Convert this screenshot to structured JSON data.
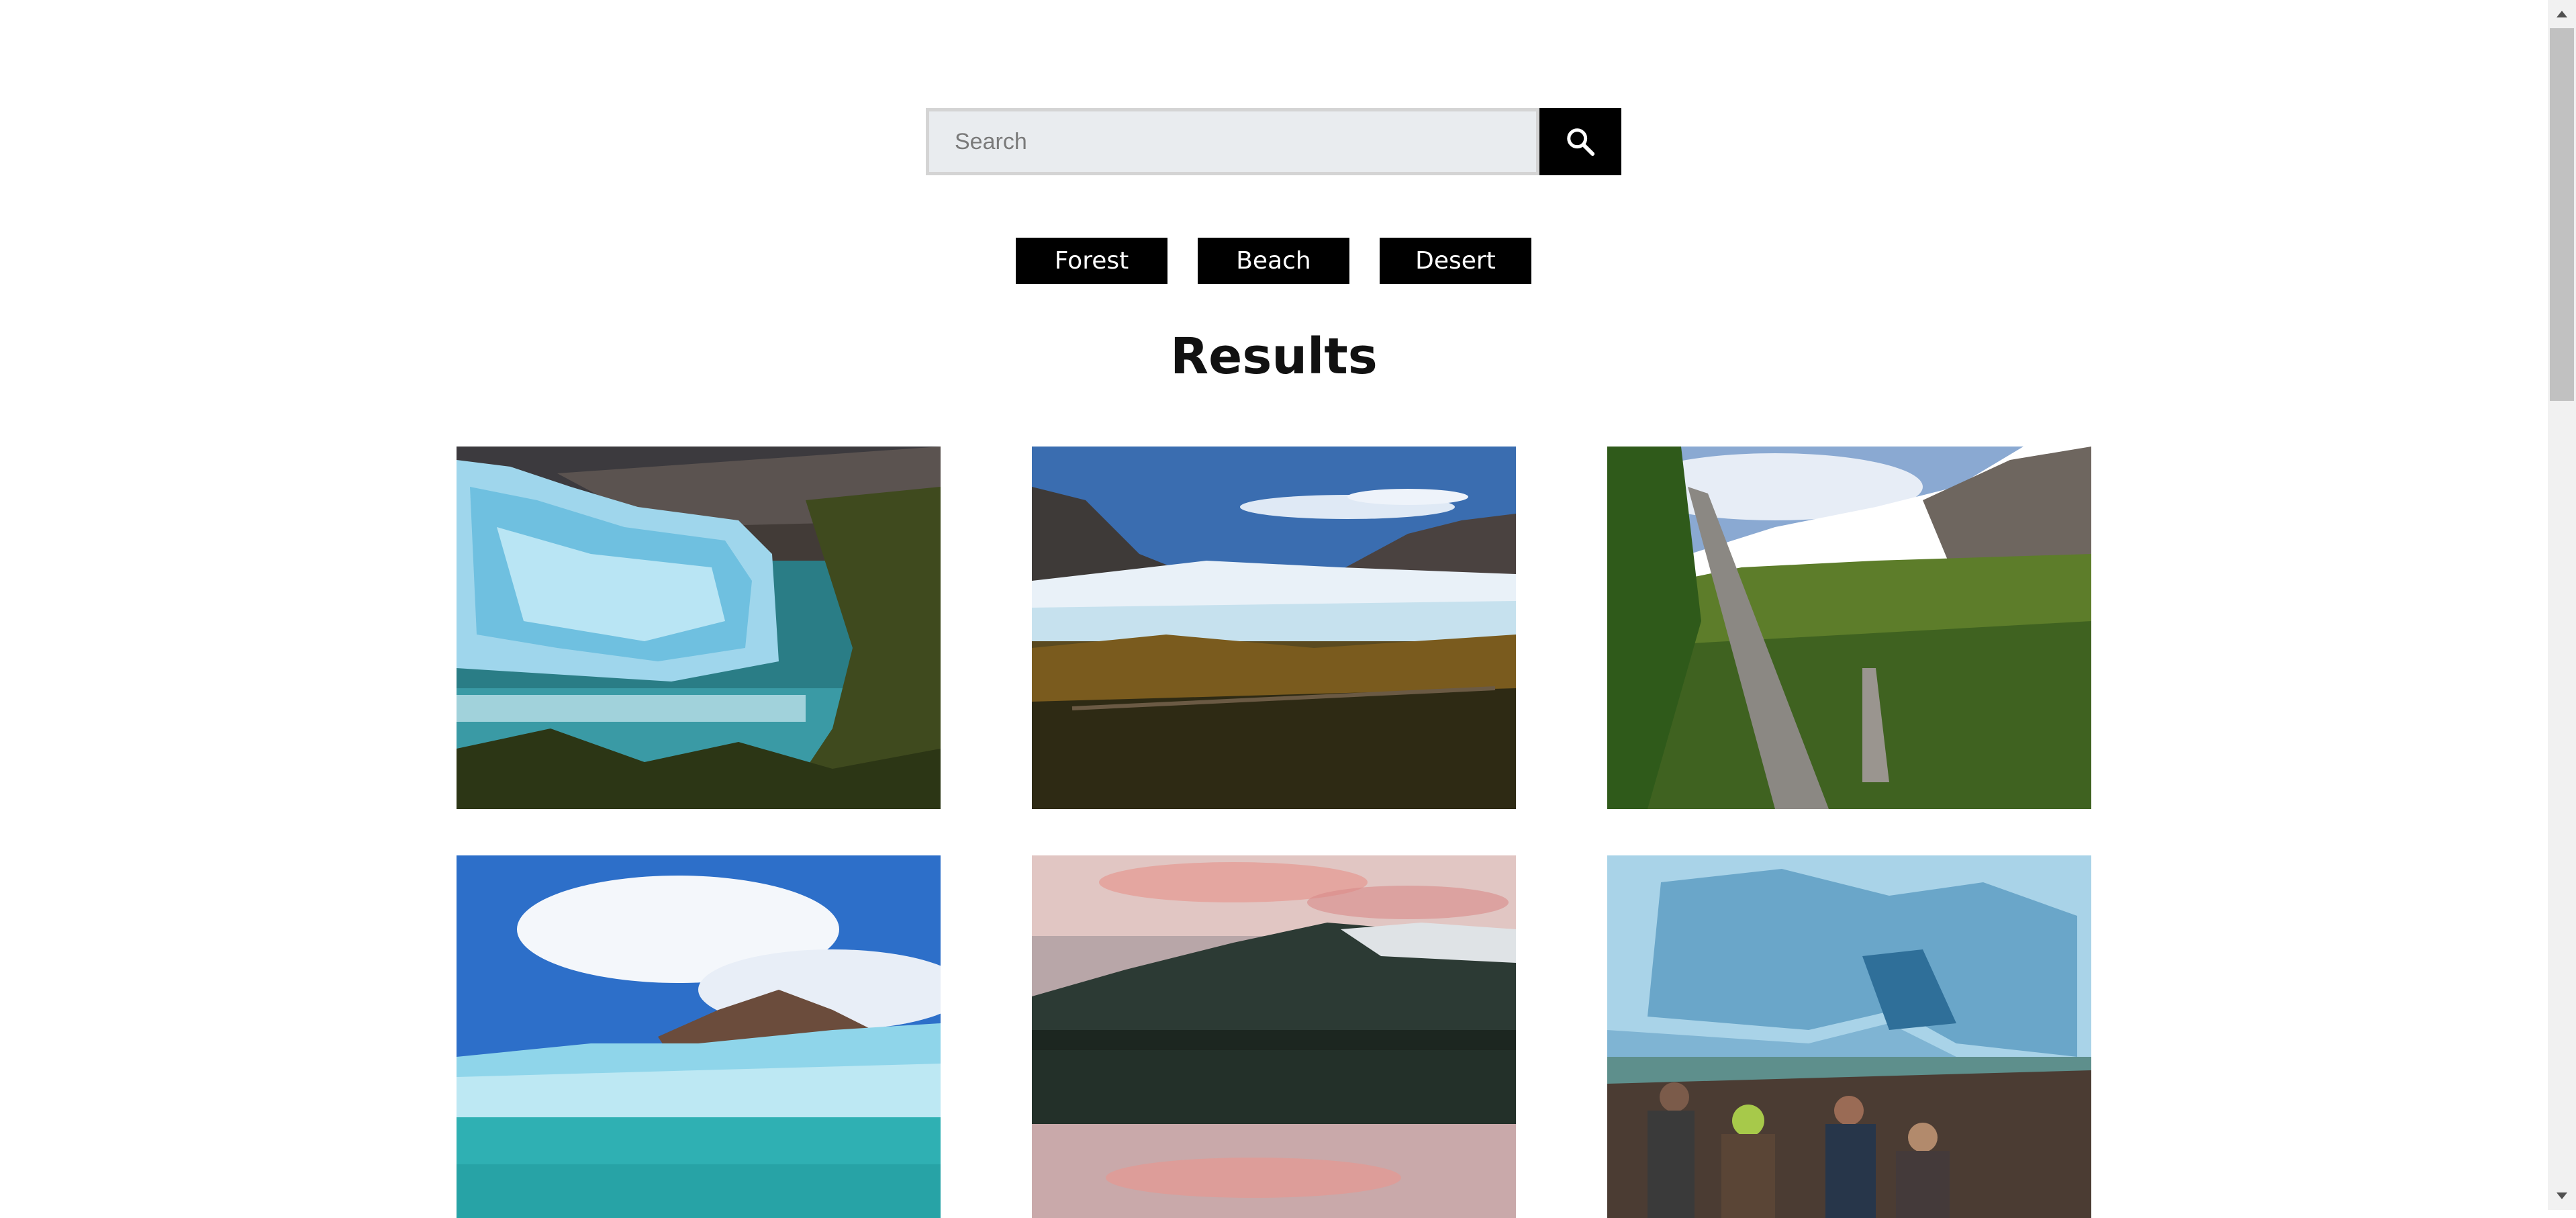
{
  "search": {
    "placeholder": "Search",
    "value": "",
    "button_icon": "search-icon"
  },
  "categories": [
    "Forest",
    "Beach",
    "Desert"
  ],
  "results": {
    "title": "Results",
    "images": [
      {
        "name": "glacier-forest-image"
      },
      {
        "name": "glacier-valley-image"
      },
      {
        "name": "dead-tree-mountain-image"
      },
      {
        "name": "glacier-lake-image"
      },
      {
        "name": "lake-reflection-sunset-image"
      },
      {
        "name": "glacier-visitors-image"
      }
    ]
  },
  "colors": {
    "button_bg": "#000000",
    "button_text": "#ffffff",
    "search_bg": "#e9ecef"
  }
}
